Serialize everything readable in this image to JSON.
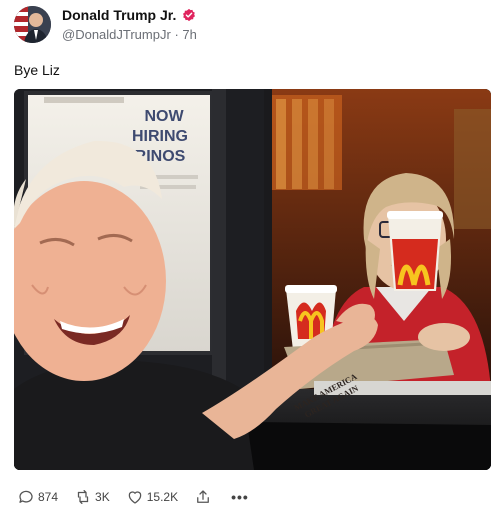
{
  "post": {
    "author": {
      "display_name": "Donald Trump Jr.",
      "handle": "@DonaldJTrumpJr",
      "separator": "·",
      "time": "7h",
      "verified": true,
      "avatar_icon": "profile-photo"
    },
    "text": "Bye Liz",
    "media": {
      "sign": {
        "line1": "NOW",
        "line2": "HIRING",
        "line3": "RINOS"
      },
      "tattoo": {
        "line1": "MAKE AMERICA",
        "line2": "GREAT AGAIN"
      }
    },
    "actions": {
      "replies": "874",
      "reposts": "3K",
      "likes": "15.2K",
      "share_icon": "share-icon",
      "more_icon": "more-icon",
      "more_label": "•••"
    },
    "colors": {
      "verified_badge": "#e0245e",
      "meta_text": "#6b6f76",
      "mcdonalds_red": "#d52b1e",
      "mcdonalds_yellow": "#f7c41f"
    }
  }
}
